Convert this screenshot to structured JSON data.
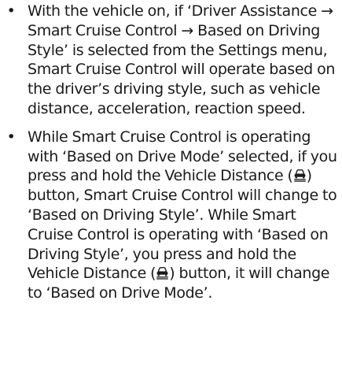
{
  "bullets": [
    {
      "marker": "•",
      "text": "With the vehicle on, if ‘Driver Assistance → Smart Cruise Control → Based on Driving Style’ is selected from the Settings menu, Smart Cruise Control will operate based on the driver’s driving style, such as vehicle distance, acceleration, reaction speed."
    },
    {
      "marker": "•",
      "segment_1": "While Smart Cruise Control is operating with ‘Based on Drive Mode’ selected, if you press and hold the Vehicle Distance (",
      "segment_2": ") button, Smart Cruise Control will change to ‘Based on Driving Style’. While Smart Cruise Control is operating with ‘Based on Driving Style’, you press and hold the Vehicle Distance (",
      "segment_3": ") button, it will change to ‘Based on Drive Mode’.",
      "icon": "vehicle-distance-icon"
    }
  ]
}
